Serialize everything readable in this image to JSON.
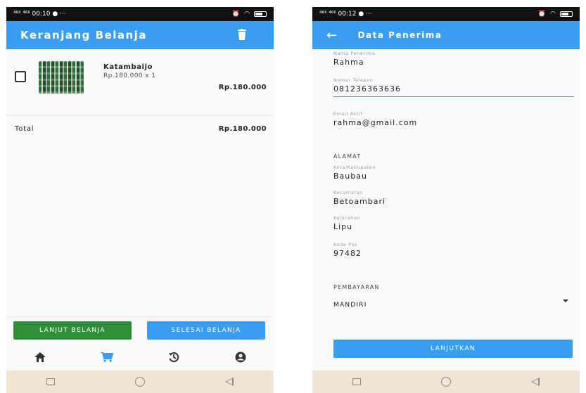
{
  "left": {
    "status": {
      "signal": "⁴⁶ᴵˡ ⁴⁶ᴵˡ",
      "time": "00:10",
      "icons": "● ···"
    },
    "appbar": {
      "title": "Keranjang Belanja",
      "action_icon": "trash-icon"
    },
    "cart": {
      "items": [
        {
          "name": "Katambaijo",
          "price_qty": "Rp.180.000 x 1",
          "subtotal": "Rp.180.000"
        }
      ],
      "total_label": "Total",
      "total_value": "Rp.180.000"
    },
    "buttons": {
      "continue": "LANJUT BELANJA",
      "finish": "SELESAI BELANJA"
    },
    "bottom_nav": [
      "home-icon",
      "cart-icon",
      "history-icon",
      "account-icon"
    ],
    "accent_color": "#3a9ef0",
    "green_color": "#2f8e3a"
  },
  "right": {
    "status": {
      "signal": "⁴⁶ᴵˡ ⁴⁶ᴵˡ",
      "time": "00:12",
      "icons": "● ···"
    },
    "appbar": {
      "title": "Data Penerima"
    },
    "fields": {
      "name": {
        "label": "Nama Penerima",
        "value": "Rahma"
      },
      "phone": {
        "label": "Nomor Telepon",
        "value": "081236363636"
      },
      "email": {
        "label": "Email Aktif",
        "value": "rahma@gmail.com"
      }
    },
    "address": {
      "title": "ALAMAT",
      "city": {
        "label": "Kota/Kabupaten",
        "value": "Baubau"
      },
      "district": {
        "label": "Kecamatan",
        "value": "Betoambari"
      },
      "village": {
        "label": "Kelurahan",
        "value": "Lipu"
      },
      "postal": {
        "label": "Kode Pos",
        "value": "97482"
      }
    },
    "payment": {
      "title": "PEMBAYARAN",
      "selected": "MANDIRI"
    },
    "submit": "LANJUTKAN"
  }
}
